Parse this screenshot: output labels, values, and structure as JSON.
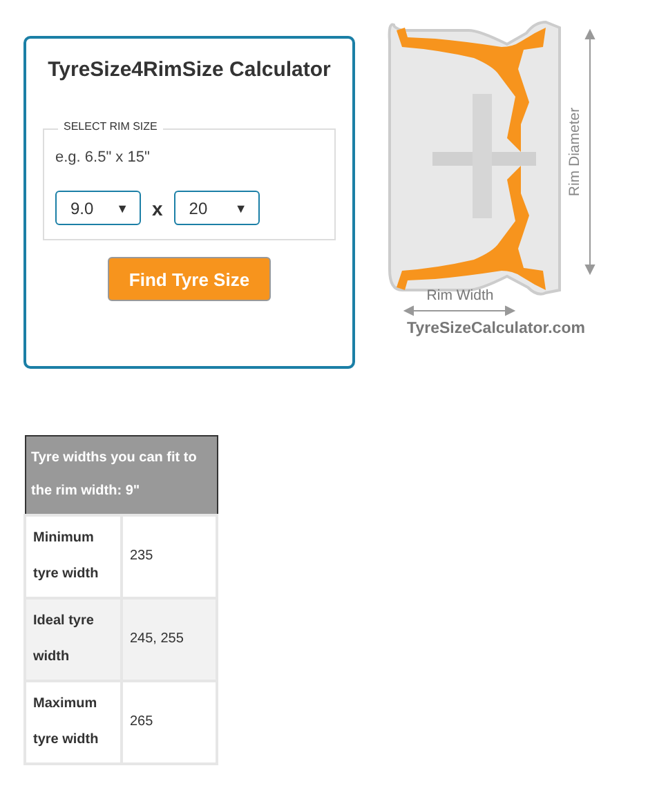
{
  "calculator": {
    "title": "TyreSize4RimSize Calculator",
    "legend": "SELECT RIM SIZE",
    "example": "e.g. 6.5\" x 15\"",
    "width_select": {
      "value": "9.0",
      "caret": "▼"
    },
    "separator": "x",
    "diameter_select": {
      "value": "20",
      "caret": "▼"
    },
    "button": "Find Tyre Size"
  },
  "diagram": {
    "diameter_label": "Rim Diameter",
    "width_label": "Rim Width",
    "site": "TyreSizeCalculator.com"
  },
  "table": {
    "header": "Tyre widths you can fit to the rim width: 9\"",
    "rows": [
      {
        "label": "Minimum tyre width",
        "value": "235"
      },
      {
        "label": "Ideal tyre width",
        "value": "245, 255"
      },
      {
        "label": "Maximum tyre width",
        "value": "265"
      }
    ]
  }
}
